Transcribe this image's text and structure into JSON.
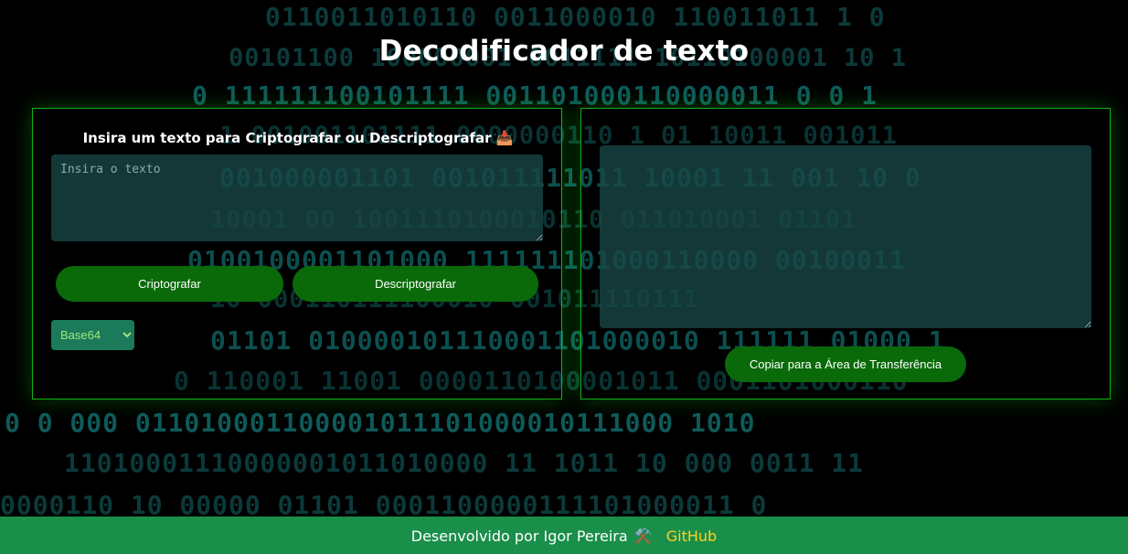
{
  "page": {
    "title": "Decodificador de texto"
  },
  "input_panel": {
    "heading": "Insira um texto para Criptografar ou Descriptografar 📥",
    "textarea_placeholder": "Insira o texto",
    "textarea_value": "",
    "encrypt_button": "Criptografar",
    "decrypt_button": "Descriptografar",
    "algorithm_select": {
      "selected": "Base64",
      "options": [
        "Base64"
      ]
    }
  },
  "output_panel": {
    "textarea_value": "",
    "copy_button": "Copiar para a Área de Transferência"
  },
  "footer": {
    "text": "Desenvolvido por Igor Pereira",
    "icon": "hammer-and-wrench-icon",
    "icon_glyph": "⚒️",
    "link_text": "GitHub"
  },
  "colors": {
    "background": "#000000",
    "panel_border": "#14b014",
    "button": "#0a6a0a",
    "textarea_bg": "#1a4646",
    "footer_bg": "#1a8f4a",
    "footer_link": "#ffd21a",
    "matrix_digits": "#0c3a3a"
  },
  "background_lines": [
    "0110011010110    0011000010   110011011 1 0",
    "00101100 100000001 0011111   10110100001  10   1",
    "0   111111100101111 001101000110000011 0 0     1",
    "1     001001101111 0000000110   1 01  10011    001011",
    "001000001101 001011111011  10001 11           001 10 0",
    "10001 00 1001110100010110 011010001 01101",
    "0100100001101000  111111101000110000  00100011",
    "10 000110111100010 001011110111",
    "01101 010000101110001101000010 111111 01000   1",
    "0   110001 11001 0000110100001011 0001101000110",
    "0  0 000 011010001100001011101000010111000 1010",
    "11010001110000001011010000 11 1011 10 000 0011 11",
    "0000110 10      00000 01101 0001100000111101000011 0"
  ]
}
